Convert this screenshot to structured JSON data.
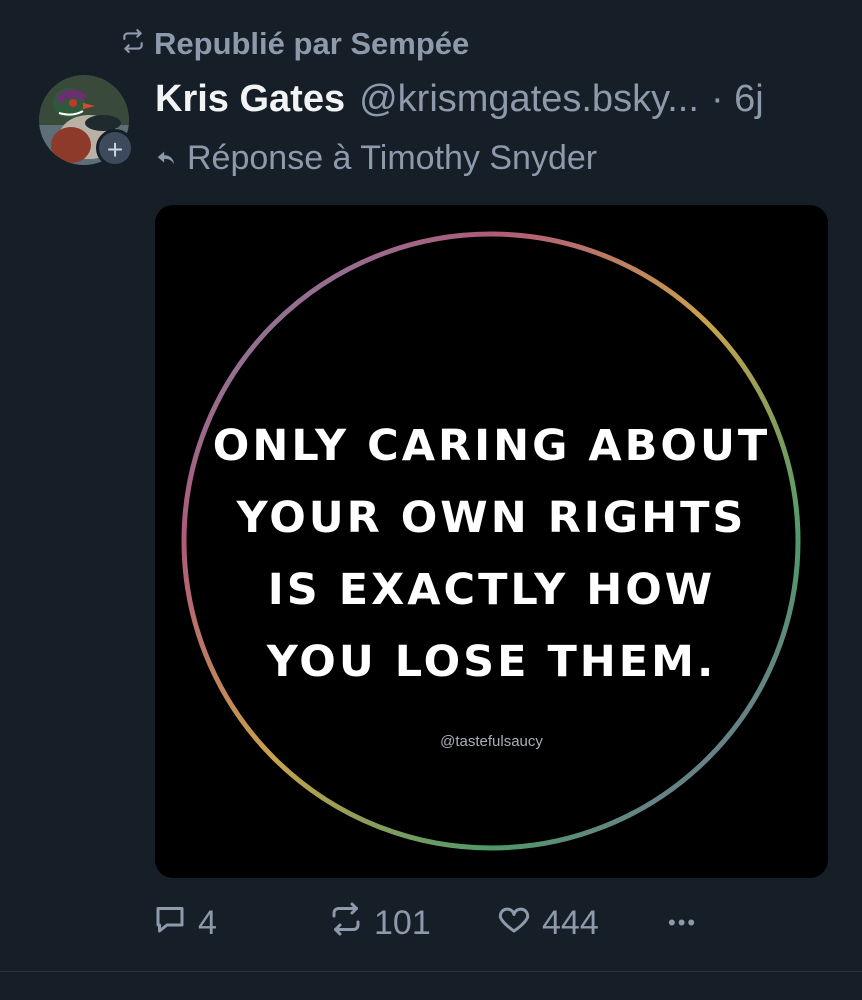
{
  "repost": {
    "icon": "repost-icon",
    "label": "Republié par Sempée"
  },
  "author": {
    "name": "Kris Gates",
    "handle": "@krismgates.bsky...",
    "time": "· 6j",
    "avatar_icon": "avatar-photo",
    "follow_icon": "plus-icon",
    "follow_label": "+"
  },
  "reply": {
    "icon": "reply-arrow-icon",
    "label": "Réponse à Timothy Snyder"
  },
  "media": {
    "text": "ONLY CARING ABOUT\nYOUR OWN RIGHTS\nIS EXACTLY HOW\nYOU LOSE THEM.",
    "watermark": "@tastefulsaucy"
  },
  "actions": {
    "replies": {
      "icon": "comment-icon",
      "count": "4"
    },
    "reposts": {
      "icon": "repost-icon",
      "count": "101"
    },
    "likes": {
      "icon": "heart-icon",
      "count": "444"
    },
    "more": {
      "icon": "more-icon",
      "label": "•••"
    }
  },
  "colors": {
    "background": "#161e27",
    "muted": "#8d9aab",
    "text": "#f1f3f5"
  }
}
